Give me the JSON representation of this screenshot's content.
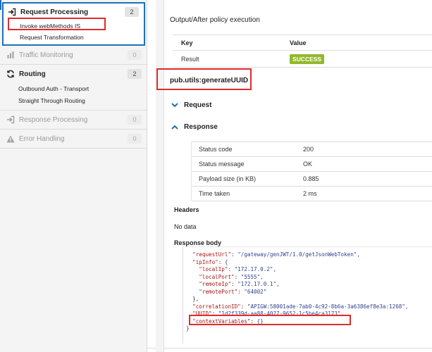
{
  "sidebar": {
    "request_processing": {
      "title": "Request Processing",
      "count": "2",
      "items": [
        "Invoke webMethods IS",
        "Request Transformation"
      ]
    },
    "traffic_monitoring": {
      "title": "Traffic Monitoring",
      "count": "0"
    },
    "routing": {
      "title": "Routing",
      "count": "2",
      "items": [
        "Outbound Auth - Transport",
        "Straight Through Routing"
      ]
    },
    "response_processing": {
      "title": "Response Processing",
      "count": "0"
    },
    "error_handling": {
      "title": "Error Handling",
      "count": "0"
    }
  },
  "main": {
    "output_section": {
      "title": "Output/After policy execution",
      "key_header": "Key",
      "value_header": "Value",
      "rows": [
        {
          "key": "Result",
          "value": "SUCCESS"
        }
      ]
    },
    "service_section": {
      "title": "pub.utils:generateUUID",
      "request_label": "Request",
      "response_label": "Response",
      "response_rows": [
        {
          "key": "Status code",
          "value": "200"
        },
        {
          "key": "Status message",
          "value": "OK"
        },
        {
          "key": "Payload size (in KB)",
          "value": "0.885"
        },
        {
          "key": "Time taken",
          "value": "2 ms"
        }
      ],
      "headers_label": "Headers",
      "headers_value": "No data",
      "response_body_label": "Response body",
      "response_body_lines": [
        "  \"requestUrl\": \"/gateway/genJWT/1.0/getJsonWebToken\",",
        "  \"ipInfo\": {",
        "    \"localIp\": \"172.17.0.2\",",
        "    \"localPort\": \"5555\",",
        "    \"remoteIp\": \"172.17.0.1\",",
        "    \"remotePort\": \"64002\"",
        "  },",
        "  \"correlationID\": \"APIGW:58001ade-7ab0-4c92-8b6a-3a6386ef8e3a:1268\",",
        "  \"UUID\": \"1d2f339d-aa88-4027-9652-1c5be4ca3173\",",
        "  \"contextVariables\": {}",
        "}"
      ]
    }
  },
  "colors": {
    "accent": "#1e70b8",
    "success": "#92b82a",
    "highlight": "#e02b2b"
  }
}
